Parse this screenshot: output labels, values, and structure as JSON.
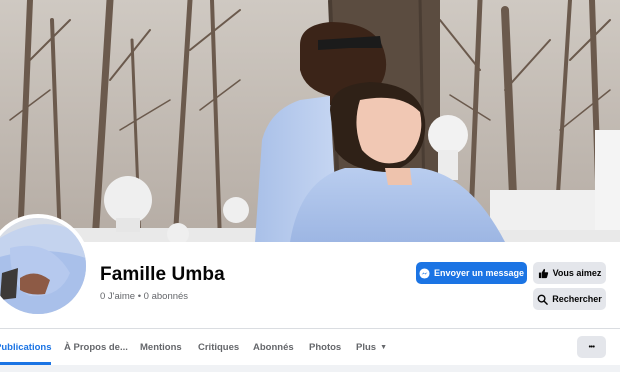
{
  "page": {
    "name": "Famille Umba",
    "stats": "0 J'aime • 0 abonnés"
  },
  "actions": {
    "message_label": "Envoyer un message",
    "like_label": "Vous aimez",
    "search_label": "Rechercher",
    "more_label": "•••"
  },
  "tabs": [
    {
      "label": "Publications",
      "active": true
    },
    {
      "label": "À Propos de..."
    },
    {
      "label": "Mentions"
    },
    {
      "label": "Critiques"
    },
    {
      "label": "Abonnés"
    },
    {
      "label": "Photos"
    },
    {
      "label": "Plus",
      "dropdown": true
    }
  ],
  "icons": {
    "message": "messenger-icon",
    "like": "thumbs-up-icon",
    "search": "search-icon",
    "more": "more-dots-icon",
    "dropdown": "caret-down-icon"
  },
  "colors": {
    "accent": "#1b74e4",
    "secondary_button": "#e4e6eb",
    "muted_text": "#65676b"
  }
}
